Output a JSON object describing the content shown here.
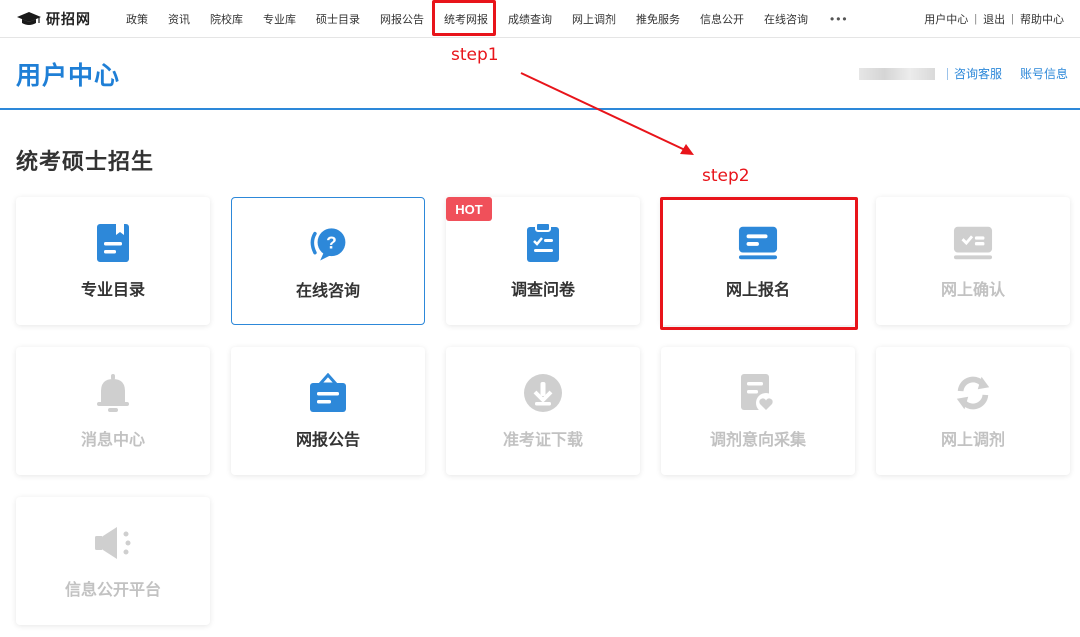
{
  "logo": {
    "text": "研招网",
    "icon": "graduation-cap-icon"
  },
  "nav": {
    "items": [
      "政策",
      "资讯",
      "院校库",
      "专业库",
      "硕士目录",
      "网报公告",
      "统考网报",
      "成绩查询",
      "网上调剂",
      "推免服务",
      "信息公开",
      "在线咨询"
    ],
    "more": "•••",
    "right": [
      "用户中心",
      "退出",
      "帮助中心"
    ]
  },
  "header": {
    "title": "用户中心",
    "links": [
      "咨询客服",
      "账号信息"
    ]
  },
  "section": {
    "title": "统考硕士招生"
  },
  "cards": [
    {
      "label": "专业目录",
      "icon": "bookmark-doc-icon",
      "enabled": true
    },
    {
      "label": "在线咨询",
      "icon": "question-bubble-icon",
      "enabled": true
    },
    {
      "label": "调查问卷",
      "icon": "clipboard-check-icon",
      "enabled": true,
      "badge": "HOT"
    },
    {
      "label": "网上报名",
      "icon": "card-form-icon",
      "enabled": true
    },
    {
      "label": "网上确认",
      "icon": "confirm-card-icon",
      "enabled": false
    },
    {
      "label": "消息中心",
      "icon": "bell-icon",
      "enabled": false
    },
    {
      "label": "网报公告",
      "icon": "announcement-bag-icon",
      "enabled": true
    },
    {
      "label": "准考证下载",
      "icon": "download-circle-icon",
      "enabled": false
    },
    {
      "label": "调剂意向采集",
      "icon": "doc-heart-icon",
      "enabled": false
    },
    {
      "label": "网上调剂",
      "icon": "refresh-icon",
      "enabled": false
    },
    {
      "label": "信息公开平台",
      "icon": "speaker-icon",
      "enabled": false
    }
  ],
  "annotations": {
    "step1": "step1",
    "step2": "step2"
  },
  "colors": {
    "accent": "#2d88d9",
    "disabled": "#c2c2c2",
    "annotation": "#e8141a",
    "hot": "#f0505a"
  }
}
